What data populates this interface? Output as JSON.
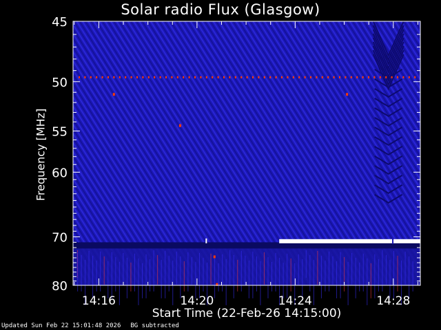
{
  "chart_data": {
    "type": "heatmap",
    "title": "Solar radio Flux (Glasgow)",
    "xlabel": "Start Time (22-Feb-26 14:15:00)",
    "ylabel": "Frequency [MHz]",
    "x_ticks": [
      "14:16",
      "14:20",
      "14:24",
      "14:28"
    ],
    "x_tick_minutes": [
      16,
      20,
      24,
      28
    ],
    "xlim_minutes": [
      14.95,
      29.1
    ],
    "y_ticks": [
      45,
      50,
      55,
      60,
      70,
      80
    ],
    "ylim": [
      45,
      80
    ],
    "y_scale": "reciprocal",
    "colors": {
      "background": "#000000",
      "plot": "#1a16b0",
      "dark_stripe": "#0a0a60",
      "emission": "#ff3a00",
      "burst": "#ffffff",
      "axes": "#ffffff"
    },
    "features": [
      {
        "label": "interference line",
        "freq_mhz": 49.6,
        "time_range": [
          "14:15",
          "14:30"
        ]
      },
      {
        "label": "saturation",
        "freq_mhz": 70.8,
        "time_range": [
          "14:23:20",
          "14:30"
        ]
      }
    ]
  },
  "footer": {
    "updated": "Updated Sun Feb 22 15:01:48 2026",
    "note": "BG subtracted"
  }
}
